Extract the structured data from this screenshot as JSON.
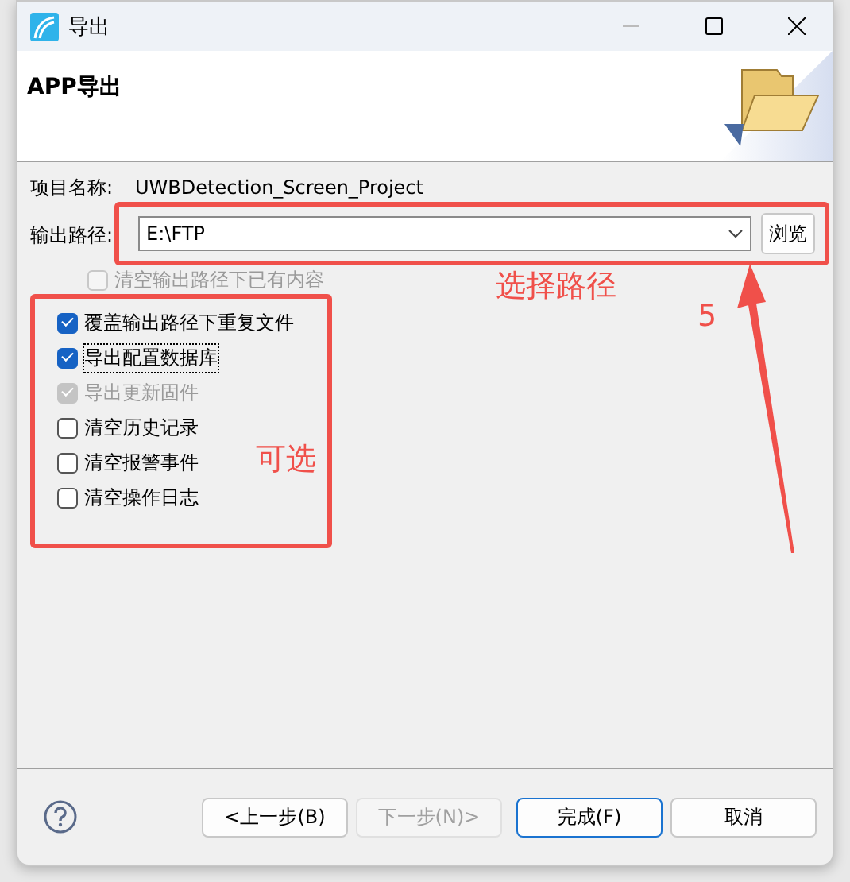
{
  "window": {
    "title": "导出"
  },
  "header": {
    "title": "APP导出"
  },
  "project": {
    "label": "项目名称:",
    "value": "UWBDetection_Screen_Project"
  },
  "output_path": {
    "label": "输出路径:",
    "value": "E:\\FTP",
    "browse_button": "浏览",
    "highlighted": true
  },
  "options": [
    {
      "label": "清空输出路径下已有内容",
      "checked": false,
      "disabled": true,
      "focused": false
    },
    {
      "label": "覆盖输出路径下重复文件",
      "checked": true,
      "disabled": false,
      "focused": false
    },
    {
      "label": "导出配置数据库",
      "checked": true,
      "disabled": false,
      "focused": true
    },
    {
      "label": "导出更新固件",
      "checked": true,
      "disabled": true,
      "focused": false
    },
    {
      "label": "清空历史记录",
      "checked": false,
      "disabled": false,
      "focused": false
    },
    {
      "label": "清空报警事件",
      "checked": false,
      "disabled": false,
      "focused": false
    },
    {
      "label": "清空操作日志",
      "checked": false,
      "disabled": false,
      "focused": false
    }
  ],
  "annotations": {
    "path_note": "选择路径",
    "step_number": "5",
    "options_note": "可选"
  },
  "buttons": [
    {
      "label": "<上一步(B)",
      "disabled": false,
      "default": false
    },
    {
      "label": "下一步(N)>",
      "disabled": true,
      "default": false
    },
    {
      "label": "完成(F)",
      "disabled": false,
      "default": true
    },
    {
      "label": "取消",
      "disabled": false,
      "default": false
    }
  ]
}
